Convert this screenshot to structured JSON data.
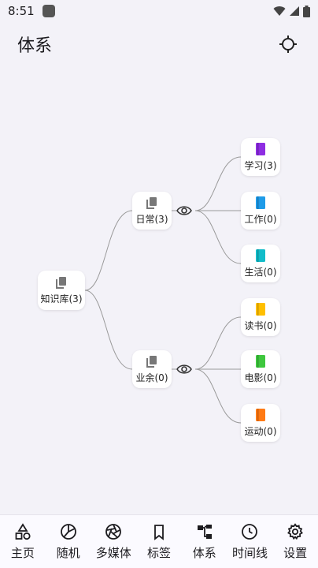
{
  "status_bar": {
    "time": "8:51"
  },
  "app_bar": {
    "title": "体系"
  },
  "tree": {
    "root": {
      "label": "知识库(3)",
      "icon": "stack-icon",
      "color": "#777777"
    },
    "groups": [
      {
        "label": "日常(3)",
        "icon": "stack-icon",
        "color": "#777777",
        "children": [
          {
            "label": "学习(3)",
            "icon": "book-icon",
            "color": "#8e2de2"
          },
          {
            "label": "工作(0)",
            "icon": "book-icon",
            "color": "#1e9be8"
          },
          {
            "label": "生活(0)",
            "icon": "book-icon",
            "color": "#12bcc9"
          }
        ]
      },
      {
        "label": "业余(0)",
        "icon": "stack-icon",
        "color": "#777777",
        "children": [
          {
            "label": "读书(0)",
            "icon": "book-icon",
            "color": "#ffbf00"
          },
          {
            "label": "电影(0)",
            "icon": "book-icon",
            "color": "#3ec73e"
          },
          {
            "label": "运动(0)",
            "icon": "book-icon",
            "color": "#ff7a14"
          }
        ]
      }
    ]
  },
  "bottom_nav": {
    "items": [
      {
        "label": "主页",
        "icon": "shapes-icon"
      },
      {
        "label": "随机",
        "icon": "random-icon"
      },
      {
        "label": "多媒体",
        "icon": "aperture-icon"
      },
      {
        "label": "标签",
        "icon": "bookmark-icon"
      },
      {
        "label": "体系",
        "icon": "hierarchy-icon"
      },
      {
        "label": "时间线",
        "icon": "clock-icon"
      },
      {
        "label": "设置",
        "icon": "gear-icon"
      }
    ]
  }
}
